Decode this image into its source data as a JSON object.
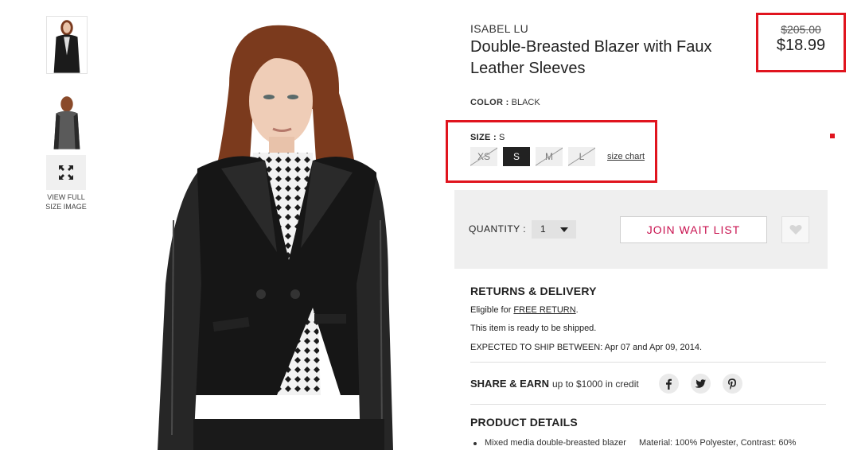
{
  "gallery": {
    "full_size_label_1": "VIEW FULL",
    "full_size_label_2": "SIZE IMAGE"
  },
  "product": {
    "brand": "ISABEL LU",
    "title": "Double-Breasted Blazer with Faux Leather Sleeves",
    "old_price": "$205.00",
    "price": "$18.99",
    "color_label": "COLOR :",
    "color_value": "BLACK",
    "size_label": "SIZE :",
    "size_value": "S",
    "sizes": [
      {
        "label": "XS",
        "available": false
      },
      {
        "label": "S",
        "available": true,
        "selected": true
      },
      {
        "label": "M",
        "available": false
      },
      {
        "label": "L",
        "available": false
      }
    ],
    "size_chart_link": "size chart"
  },
  "purchase": {
    "quantity_label": "QUANTITY :",
    "quantity_value": "1",
    "wait_list_button": "JOIN WAIT LIST",
    "wishlist_icon": "heart-icon"
  },
  "returns": {
    "title": "RETURNS & DELIVERY",
    "eligible_prefix": "Eligible for",
    "free_return_link": "FREE RETURN",
    "eligible_suffix": ".",
    "ready_text": "This item is ready to be shipped.",
    "ship_prefix": "EXPECTED TO SHIP BETWEEN:",
    "ship_dates": "Apr 07 and Apr 09, 2014."
  },
  "share": {
    "title": "SHARE & EARN",
    "subtitle": "up to $1000 in credit",
    "icons": [
      "facebook-icon",
      "twitter-icon",
      "pinterest-icon"
    ]
  },
  "details": {
    "title": "PRODUCT DETAILS",
    "bullet": "Mixed media double-breasted blazer",
    "material": "Material: 100% Polyester, Contrast: 60%"
  },
  "colors": {
    "highlight": "#e0141e",
    "wait_list_text": "#c8104e",
    "panel_bg": "#efefef",
    "selected_size_bg": "#222222"
  }
}
